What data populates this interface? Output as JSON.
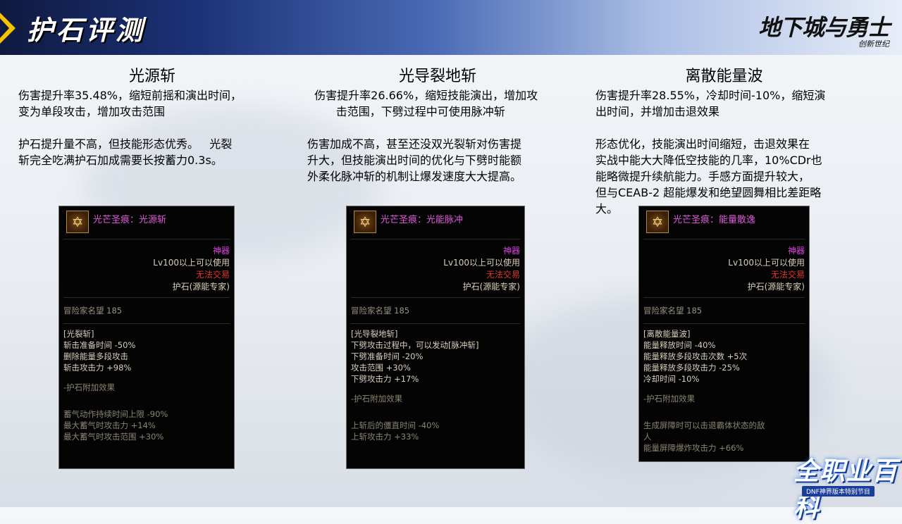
{
  "header": {
    "title": "护石评测",
    "logo_main": "地下城与勇士",
    "logo_sub": "创新世纪"
  },
  "columns": [
    {
      "title": "光源斩",
      "text": "伤害提升率35.48%，缩短前摇和演出时间，\n变为单段攻击，增加攻击范围\n\n护石提升量不高，但技能形态优秀。   光裂\n斩完全吃满护石加成需要长按蓄力0.3s。"
    },
    {
      "title": "光导裂地斩",
      "text": "  伤害提升率26.66%，缩短技能演出，增加攻\n        击范围，下劈过程中可使用脉冲斩\n\n伤害加成不高，甚至还没双光裂斩对伤害提\n升大，但技能演出时间的优化与下劈时能额\n外柔化脉冲斩的机制让爆发速度大大提高。"
    },
    {
      "title": "离散能量波",
      "text": "伤害提升率28.55%，冷却时间-10%，缩短演\n出时间，并增加击退效果\n\n形态优化，技能演出时间缩短，击退效果在\n实战中能大大降低空技能的几率，10%CDr也\n能略微提升续航能力。手感方面提升较大，\n但与CEAB-2 超能爆发和绝望圆舞相比差距略\n大。"
    }
  ],
  "tooltips": [
    {
      "name": "光芒圣痕：光源斩",
      "rarity": "神器",
      "level": "Lv100以上可以使用",
      "trade": "无法交易",
      "category": "护石(源能专家)",
      "fame": "冒险家名望 185",
      "skill_lines": [
        "[光裂斩]",
        "斩击准备时间 -50%",
        "删除能量多段攻击",
        "斩击攻击力 +98%"
      ],
      "extra_header": "-护石附加效果",
      "extra_lines": [
        "蓄气动作持续时间上限 -90%",
        "最大蓄气时攻击力 +14%",
        "最大蓄气时攻击范围 +30%"
      ]
    },
    {
      "name": "光芒圣痕：光能脉冲",
      "rarity": "神器",
      "level": "Lv100以上可以使用",
      "trade": "无法交易",
      "category": "护石(源能专家)",
      "fame": "冒险家名望 185",
      "skill_lines": [
        "[光导裂地斩]",
        "下劈攻击过程中，可以发动[脉冲斩]",
        "下劈准备时间 -20%",
        "攻击范围 +30%",
        "下劈攻击力 +17%"
      ],
      "extra_header": "-护石附加效果",
      "extra_lines": [
        "上斩后的僵直时间 -40%",
        "上斩攻击力 +33%"
      ]
    },
    {
      "name": "光芒圣痕：能量散逸",
      "rarity": "神器",
      "level": "Lv100以上可以使用",
      "trade": "无法交易",
      "category": "护石(源能专家)",
      "fame": "冒险家名望 185",
      "skill_lines": [
        "[离散能量波]",
        "能量释放时间 -40%",
        "能量释放多段攻击次数 +5次",
        "能量释放多段攻击力 -25%",
        "冷却时间 -10%"
      ],
      "extra_header": "-护石附加效果",
      "extra_lines": [
        "生成屏障时可以击退霸体状态的敌",
        "人",
        "能量屏障爆炸攻击力 +66%"
      ]
    }
  ],
  "badge": {
    "main": "全职业百科",
    "sub": "DNF神界版本特别节目"
  },
  "colors": {
    "accent_yellow": "#f5c400",
    "header_navy": "#0f1a40",
    "rarity_purple": "#e040e8",
    "trade_red": "#e0362e"
  }
}
